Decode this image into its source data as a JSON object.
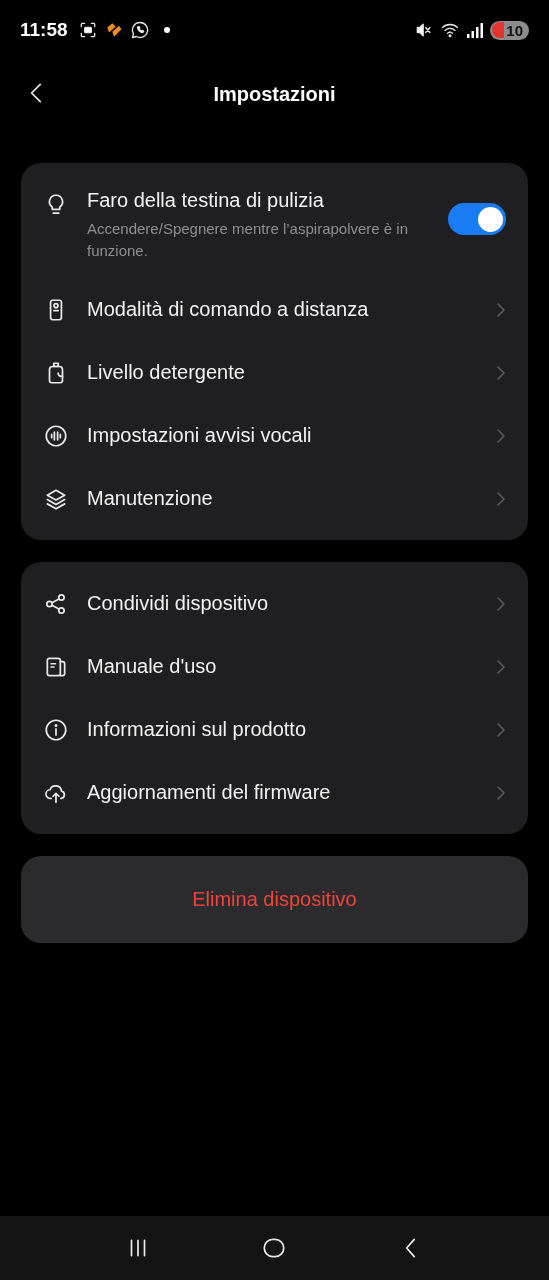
{
  "status_bar": {
    "time": "11:58",
    "battery": "10"
  },
  "header": {
    "title": "Impostazioni"
  },
  "sections": [
    {
      "items": [
        {
          "kind": "toggle",
          "label": "Faro della testina di pulizia",
          "description": "Accendere/Spegnere mentre l’aspirapolvere è in funzione.",
          "on": true
        },
        {
          "kind": "link",
          "label": "Modalità di comando a distanza"
        },
        {
          "kind": "link",
          "label": "Livello detergente"
        },
        {
          "kind": "link",
          "label": "Impostazioni avvisi vocali"
        },
        {
          "kind": "link",
          "label": "Manutenzione"
        }
      ]
    },
    {
      "items": [
        {
          "kind": "link",
          "label": "Condividi dispositivo"
        },
        {
          "kind": "link",
          "label": "Manuale d'uso"
        },
        {
          "kind": "link",
          "label": "Informazioni sul prodotto"
        },
        {
          "kind": "link",
          "label": "Aggiornamenti del firmware"
        }
      ]
    }
  ],
  "delete_button": {
    "label": "Elimina dispositivo"
  }
}
